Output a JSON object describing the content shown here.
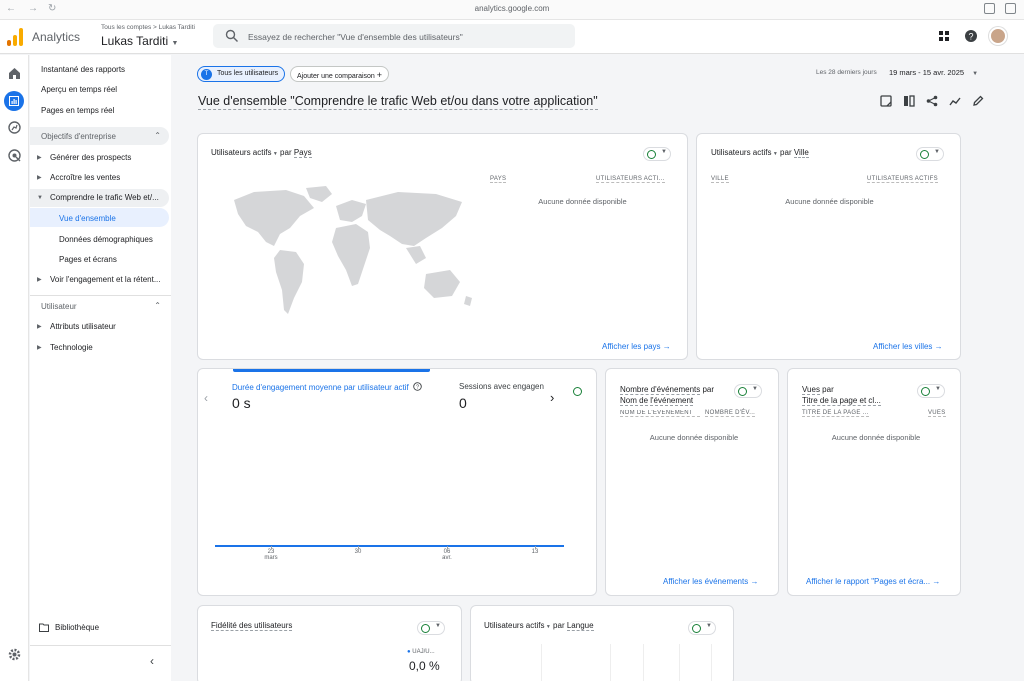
{
  "browser": {
    "url": "analytics.google.com"
  },
  "header": {
    "app_name": "Analytics",
    "account_path": "Tous les comptes > Lukas Tarditi",
    "account_name": "Lukas Tarditi",
    "search_placeholder": "Essayez de rechercher \"Vue d'ensemble des utilisateurs\""
  },
  "sidebar": {
    "top_items": [
      "Instantané des rapports",
      "Aperçu en temps réel",
      "Pages en temps réel"
    ],
    "section1": "Objectifs d'entreprise",
    "section1_items": [
      "Générer des prospects",
      "Accroître les ventes",
      "Comprendre le trafic Web et/...",
      "Voir l'engagement et la rétent..."
    ],
    "section1_sub": [
      "Vue d'ensemble",
      "Données démographiques",
      "Pages et écrans"
    ],
    "section2": "Utilisateur",
    "section2_items": [
      "Attributs utilisateur",
      "Technologie"
    ],
    "library": "Bibliothèque"
  },
  "toolbar": {
    "chip_letter": "T",
    "chip_all": "Tous les utilisateurs",
    "chip_add": "Ajouter une comparaison",
    "date_label": "Les 28 derniers jours",
    "date_range": "19 mars - 15 avr. 2025"
  },
  "page_title": "Vue d'ensemble \"Comprendre le trafic Web et/ou dans votre application\"",
  "cards": {
    "country": {
      "title_metric": "Utilisateurs actifs",
      "title_by": "par",
      "title_dim": "Pays",
      "col1": "PAYS",
      "col2": "UTILISATEURS ACTI...",
      "nodata": "Aucune donnée disponible",
      "link": "Afficher les pays"
    },
    "city": {
      "title_metric": "Utilisateurs actifs",
      "title_by": "par",
      "title_dim": "Ville",
      "col1": "VILLE",
      "col2": "UTILISATEURS ACTIFS",
      "nodata": "Aucune donnée disponible",
      "link": "Afficher les villes"
    },
    "engagement": {
      "metric1_label": "Durée d'engagement moyenne par utilisateur actif",
      "metric1_value": "0 s",
      "metric2_label": "Sessions avec engagen",
      "metric2_value": "0",
      "xticks": [
        {
          "day": "23",
          "month": "mars"
        },
        {
          "day": "30",
          "month": ""
        },
        {
          "day": "06",
          "month": "avr."
        },
        {
          "day": "13",
          "month": ""
        }
      ]
    },
    "events": {
      "title1": "Nombre d'événements",
      "title_by": "par",
      "title2": "Nom de l'événement",
      "col1": "NOM DE L'ÉVÉNEMENT",
      "col2": "NOMBRE D'ÉV...",
      "nodata": "Aucune donnée disponible",
      "link": "Afficher les événements"
    },
    "views": {
      "title1": "Vues",
      "title_by": "par",
      "title2": "Titre de la page et cl...",
      "col1": "TITRE DE LA PAGE ...",
      "col2": "VUES",
      "nodata": "Aucune donnée disponible",
      "link": "Afficher le rapport \"Pages et écra..."
    },
    "fidelity": {
      "title": "Fidélité des utilisateurs",
      "legend": "UAJ/U...",
      "value": "0,0 %"
    },
    "language": {
      "title_metric": "Utilisateurs actifs",
      "title_by": "par",
      "title_dim": "Langue"
    }
  },
  "colors": {
    "accent": "#1a73e8",
    "success": "#188038",
    "logo_orange": "#f9ab00",
    "logo_dark": "#e37400"
  }
}
